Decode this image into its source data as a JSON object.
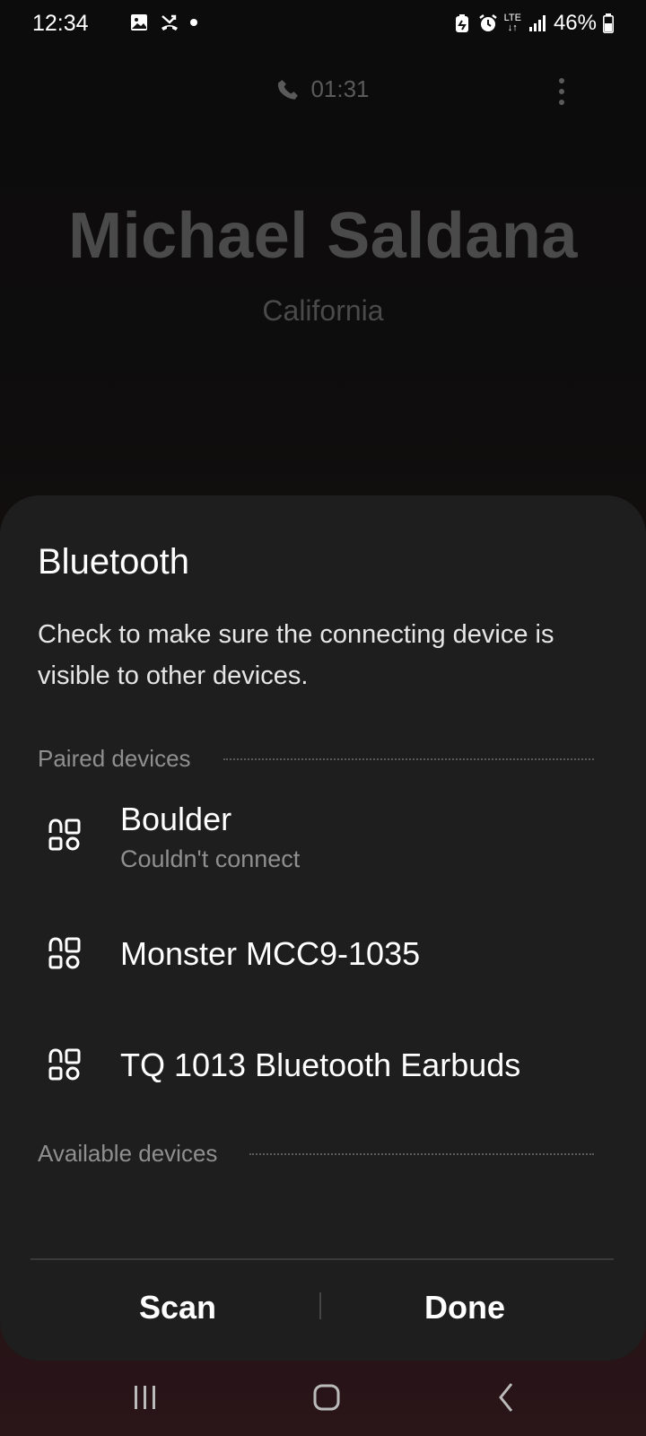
{
  "status_bar": {
    "time": "12:34",
    "network": "LTE",
    "battery": "46%"
  },
  "call": {
    "timer": "01:31",
    "caller_name": "Michael Saldana",
    "caller_location": "California"
  },
  "bluetooth_sheet": {
    "title": "Bluetooth",
    "description": "Check to make sure the connecting device is visible to other devices.",
    "paired_label": "Paired devices",
    "paired_devices": [
      {
        "name": "Boulder",
        "status": "Couldn't connect"
      },
      {
        "name": "Monster MCC9-1035",
        "status": ""
      },
      {
        "name": "TQ 1013 Bluetooth Earbuds",
        "status": ""
      }
    ],
    "available_label": "Available devices",
    "scan_label": "Scan",
    "done_label": "Done"
  },
  "colors": {
    "sheet_bg": "#1e1e1e",
    "muted_text": "#8f8f8f",
    "dim_call_text": "#4a4a4a"
  },
  "icons": [
    "gallery-icon",
    "missed-call-icon",
    "notification-dot-icon",
    "battery-saver-icon",
    "alarm-icon",
    "lte-icon",
    "signal-icon",
    "battery-icon",
    "phone-icon",
    "more-vert-icon",
    "audio-device-icon",
    "recents-icon",
    "home-icon",
    "back-icon"
  ]
}
